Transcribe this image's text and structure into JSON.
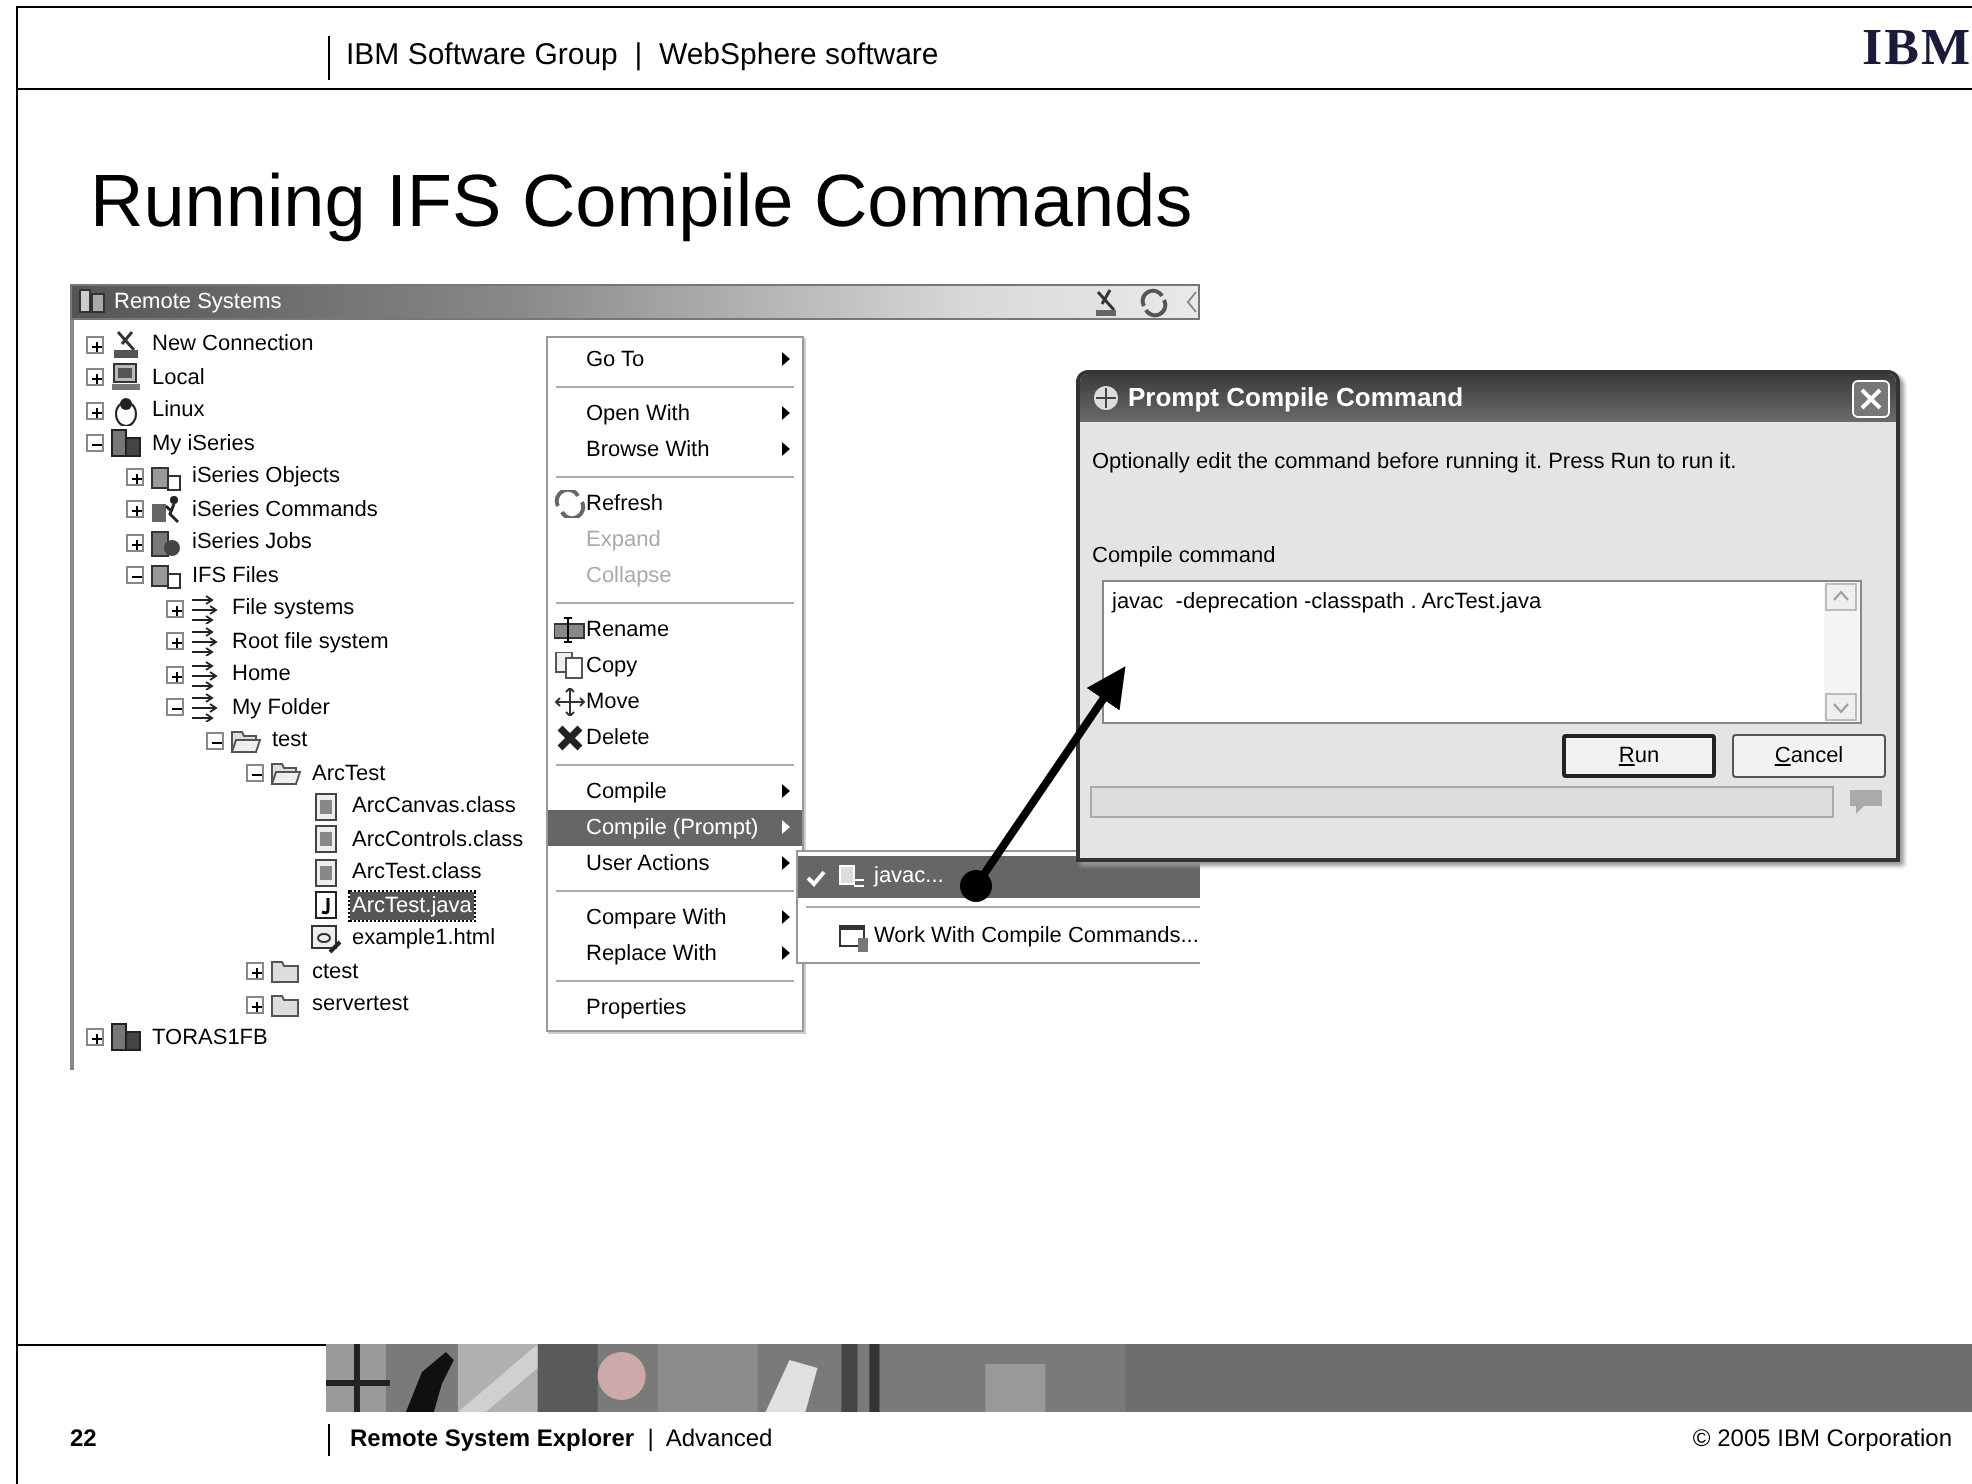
{
  "header": {
    "text": "IBM Software Group  |  WebSphere software",
    "logo": "IBM"
  },
  "title": "Running IFS Compile Commands",
  "remote_systems": {
    "title": "Remote Systems",
    "tree": [
      {
        "label": "New Connection",
        "kind": "connection",
        "expanded": false,
        "selected": false
      },
      {
        "label": "Local",
        "kind": "computer",
        "expanded": false,
        "selected": false
      },
      {
        "label": "Linux",
        "kind": "linux",
        "expanded": false,
        "selected": false
      },
      {
        "label": "My iSeries",
        "kind": "server",
        "expanded": true,
        "selected": false,
        "children": [
          {
            "label": "iSeries Objects",
            "kind": "objects",
            "expanded": false,
            "selected": false
          },
          {
            "label": "iSeries Commands",
            "kind": "commands",
            "expanded": false,
            "selected": false
          },
          {
            "label": "iSeries Jobs",
            "kind": "jobs",
            "expanded": false,
            "selected": false
          },
          {
            "label": "IFS Files",
            "kind": "objects",
            "expanded": true,
            "selected": false,
            "children": [
              {
                "label": "File systems",
                "kind": "filter",
                "expanded": false,
                "selected": false
              },
              {
                "label": "Root file system",
                "kind": "filter",
                "expanded": false,
                "selected": false
              },
              {
                "label": "Home",
                "kind": "filter",
                "expanded": false,
                "selected": false
              },
              {
                "label": "My Folder",
                "kind": "filter",
                "expanded": true,
                "selected": false,
                "children": [
                  {
                    "label": "test",
                    "kind": "folder",
                    "expanded": true,
                    "selected": false,
                    "children": [
                      {
                        "label": "ArcTest",
                        "kind": "folder",
                        "expanded": true,
                        "selected": false,
                        "children": [
                          {
                            "label": "ArcCanvas.class",
                            "kind": "classfile",
                            "selected": false
                          },
                          {
                            "label": "ArcControls.class",
                            "kind": "classfile",
                            "selected": false
                          },
                          {
                            "label": "ArcTest.class",
                            "kind": "classfile",
                            "selected": false
                          },
                          {
                            "label": "ArcTest.java",
                            "kind": "java",
                            "selected": true
                          },
                          {
                            "label": "example1.html",
                            "kind": "html",
                            "selected": false
                          }
                        ]
                      },
                      {
                        "label": "ctest",
                        "kind": "folder",
                        "expanded": false,
                        "selected": false
                      },
                      {
                        "label": "servertest",
                        "kind": "folder",
                        "expanded": false,
                        "selected": false
                      }
                    ]
                  }
                ]
              }
            ]
          }
        ]
      },
      {
        "label": "TORAS1FB",
        "kind": "server",
        "expanded": false,
        "selected": false
      }
    ]
  },
  "context_menu": {
    "groups": [
      [
        {
          "label": "Go To",
          "kind": "plain",
          "submenu": true,
          "disabled": false,
          "selected": false
        }
      ],
      [
        {
          "label": "Open With",
          "kind": "plain",
          "submenu": true,
          "disabled": false,
          "selected": false
        },
        {
          "label": "Browse With",
          "kind": "plain",
          "submenu": true,
          "disabled": false,
          "selected": false
        }
      ],
      [
        {
          "label": "Refresh",
          "kind": "refresh",
          "submenu": false,
          "disabled": false,
          "selected": false
        },
        {
          "label": "Expand",
          "kind": "plain",
          "submenu": false,
          "disabled": true,
          "selected": false
        },
        {
          "label": "Collapse",
          "kind": "plain",
          "submenu": false,
          "disabled": true,
          "selected": false
        }
      ],
      [
        {
          "label": "Rename",
          "kind": "rename",
          "submenu": false,
          "disabled": false,
          "selected": false
        },
        {
          "label": "Copy",
          "kind": "copy",
          "submenu": false,
          "disabled": false,
          "selected": false
        },
        {
          "label": "Move",
          "kind": "move",
          "submenu": false,
          "disabled": false,
          "selected": false
        },
        {
          "label": "Delete",
          "kind": "delete",
          "submenu": false,
          "disabled": false,
          "selected": false
        }
      ],
      [
        {
          "label": "Compile",
          "kind": "plain",
          "submenu": true,
          "disabled": false,
          "selected": false
        },
        {
          "label": "Compile (Prompt)",
          "kind": "plain",
          "submenu": true,
          "disabled": false,
          "selected": true
        },
        {
          "label": "User Actions",
          "kind": "plain",
          "submenu": true,
          "disabled": false,
          "selected": false
        }
      ],
      [
        {
          "label": "Compare With",
          "kind": "plain",
          "submenu": true,
          "disabled": false,
          "selected": false
        },
        {
          "label": "Replace With",
          "kind": "plain",
          "submenu": true,
          "disabled": false,
          "selected": false
        }
      ],
      [
        {
          "label": "Properties",
          "kind": "plain",
          "submenu": false,
          "disabled": false,
          "selected": false
        }
      ]
    ]
  },
  "submenu": {
    "groups": [
      [
        {
          "label": "javac...",
          "kind": "command",
          "checked": true,
          "selected": true
        }
      ],
      [
        {
          "label": "Work With Compile Commands...",
          "kind": "workwith",
          "checked": false,
          "selected": false
        }
      ]
    ]
  },
  "dialog": {
    "title": "Prompt Compile Command",
    "message": "Optionally edit the command before running it. Press Run to run it.",
    "field_label": "Compile command",
    "command": "javac  -deprecation -classpath . ArcTest.java",
    "buttons": [
      {
        "label": "Run",
        "default": true,
        "underline_first": true
      },
      {
        "label": "Cancel",
        "default": false,
        "underline_first": true
      }
    ]
  },
  "footer": {
    "page": "22",
    "text": "**Remote System Explorer**  |  Advanced",
    "copyright": "© 2005 IBM Corporation"
  }
}
